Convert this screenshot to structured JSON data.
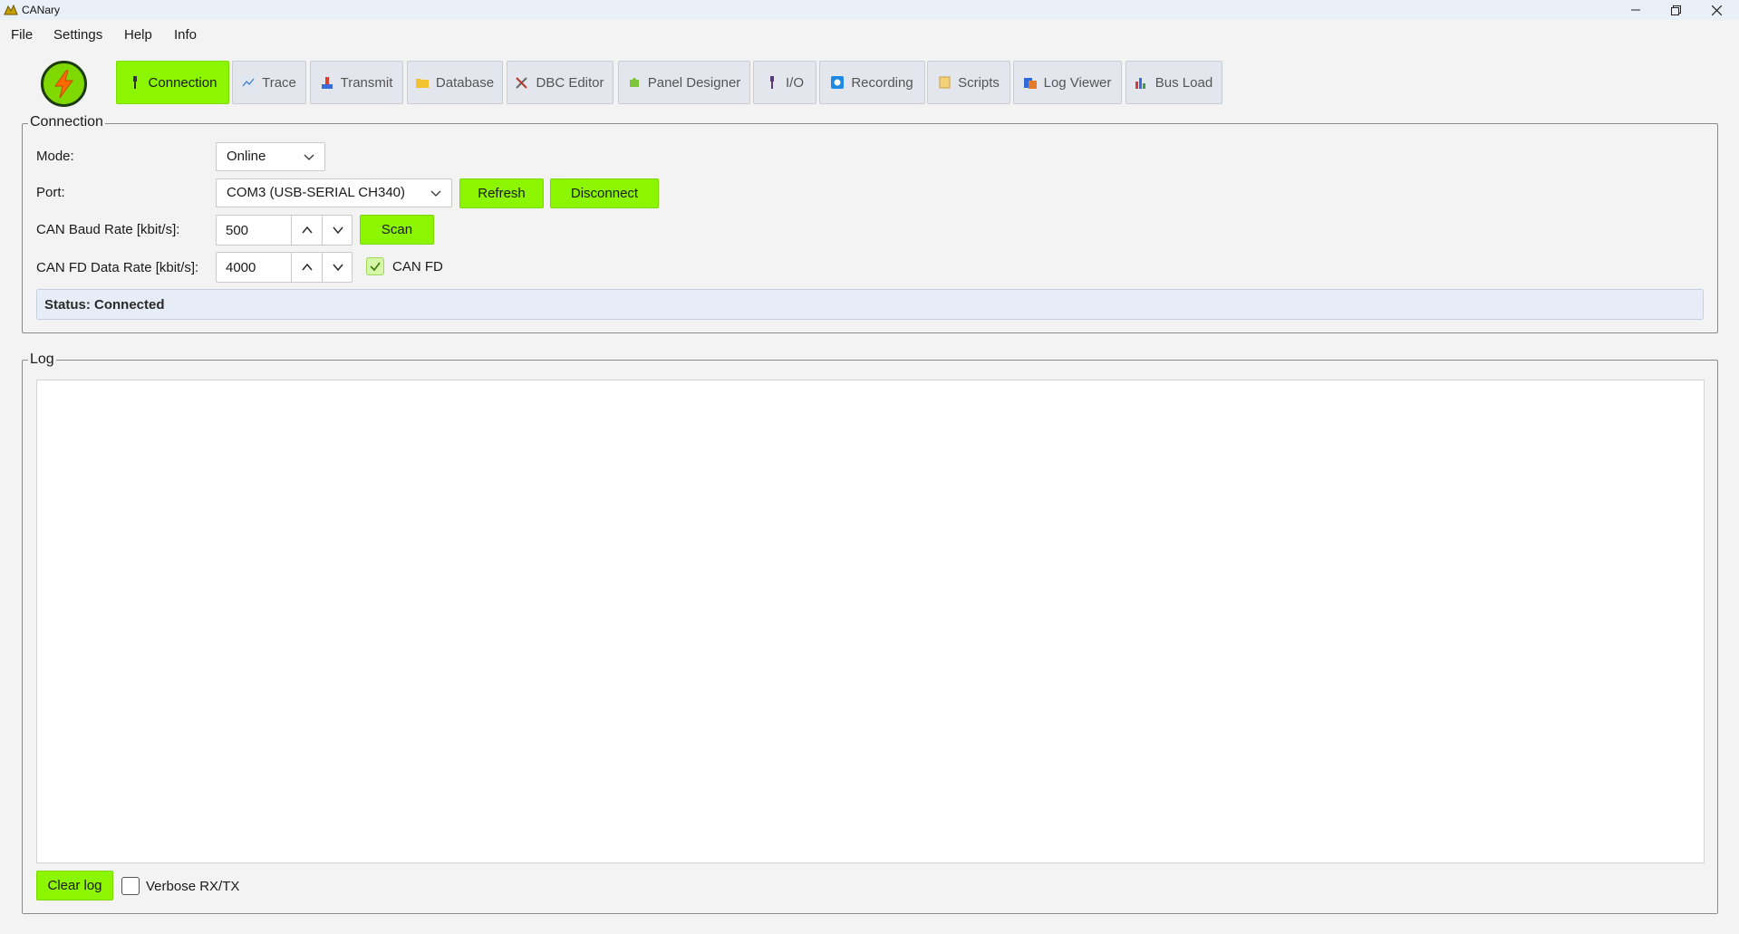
{
  "window": {
    "title": "CANary",
    "minimize": "—",
    "maximize": "❐",
    "close": "✕"
  },
  "menu": [
    "File",
    "Settings",
    "Help",
    "Info"
  ],
  "logo": {
    "icon": "lightning-bolt-icon"
  },
  "tabs": [
    {
      "label": "Connection",
      "icon": "plug-icon",
      "active": true
    },
    {
      "label": "Trace",
      "icon": "chart-icon",
      "active": false
    },
    {
      "label": "Transmit",
      "icon": "transmit-icon",
      "active": false
    },
    {
      "label": "Database",
      "icon": "folder-icon",
      "active": false
    },
    {
      "label": "DBC Editor",
      "icon": "tools-icon",
      "active": false
    },
    {
      "label": "Panel Designer",
      "icon": "puzzle-icon",
      "active": false
    },
    {
      "label": "I/O",
      "icon": "plug-icon",
      "active": false
    },
    {
      "label": "Recording",
      "icon": "record-icon",
      "active": false
    },
    {
      "label": "Scripts",
      "icon": "scroll-icon",
      "active": false
    },
    {
      "label": "Log Viewer",
      "icon": "log-icon",
      "active": false
    },
    {
      "label": "Bus Load",
      "icon": "bar-chart-icon",
      "active": false
    }
  ],
  "connection": {
    "title": "Connection",
    "mode_label": "Mode:",
    "mode_value": "Online",
    "port_label": "Port:",
    "port_value": "COM3 (USB-SERIAL CH340)",
    "refresh_label": "Refresh",
    "disconnect_label": "Disconnect",
    "baud_label": "CAN Baud Rate [kbit/s]:",
    "baud_value": "500",
    "scan_label": "Scan",
    "fd_label": "CAN FD Data Rate [kbit/s]:",
    "fd_value": "4000",
    "canfd_checkbox_label": "CAN FD",
    "canfd_checked": true,
    "status": "Status: Connected"
  },
  "log": {
    "title": "Log",
    "clear_label": "Clear log",
    "verbose_label": "Verbose RX/TX",
    "verbose_checked": false
  },
  "colors": {
    "accent": "#8cf500",
    "status_bg": "#e7edf6",
    "titlebar_bg": "#eaf0f8"
  }
}
